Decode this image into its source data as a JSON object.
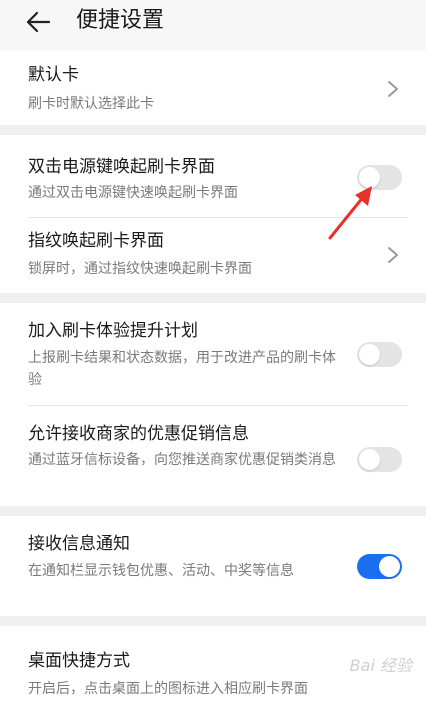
{
  "header": {
    "title": "便捷设置"
  },
  "settings": {
    "default_card": {
      "title": "默认卡",
      "subtitle": "刷卡时默认选择此卡"
    },
    "double_click_power": {
      "title": "双击电源键唤起刷卡界面",
      "subtitle": "通过双击电源键快速唤起刷卡界面",
      "enabled": false
    },
    "fingerprint_wake": {
      "title": "指纹唤起刷卡界面",
      "subtitle": "锁屏时，通过指纹快速唤起刷卡界面"
    },
    "experience_plan": {
      "title": "加入刷卡体验提升计划",
      "subtitle": "上报刷卡结果和状态数据，用于改进产品的刷卡体验",
      "enabled": false
    },
    "merchant_promo": {
      "title": "允许接收商家的优惠促销信息",
      "subtitle": "通过蓝牙信标设备，向您推送商家优惠促销类消息",
      "enabled": false
    },
    "message_notification": {
      "title": "接收信息通知",
      "subtitle": "在通知栏显示钱包优惠、活动、中奖等信息",
      "enabled": true
    },
    "desktop_shortcut": {
      "title": "桌面快捷方式",
      "subtitle": "开启后，点击桌面上的图标进入相应刷卡界面"
    }
  },
  "colors": {
    "accent": "#1a6ff0",
    "annotation_arrow": "#e8312a"
  },
  "watermark": "Bai 经验"
}
